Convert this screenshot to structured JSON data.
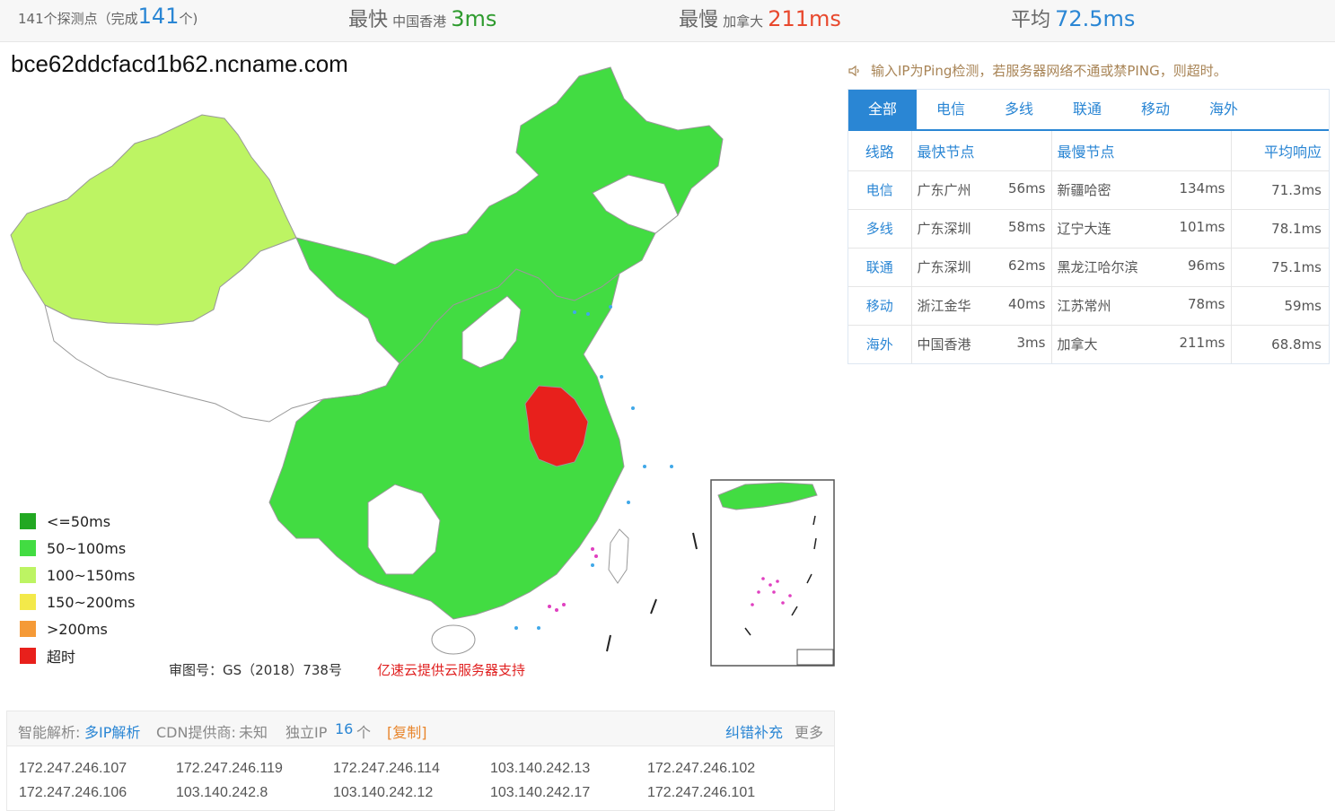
{
  "stats": {
    "count_prefix": "141个探测点（完成",
    "count_num": "141",
    "count_suffix": "个)",
    "fast_label": "最快",
    "fast_loc": "中国香港",
    "fast_val": "3ms",
    "slow_label": "最慢",
    "slow_loc": "加拿大",
    "slow_val": "211ms",
    "avg_label": "平均",
    "avg_val": "72.5ms"
  },
  "domain": "bce62ddcfacd1b62.ncname.com",
  "legend": [
    {
      "label": "<=50ms",
      "color": "#22a822"
    },
    {
      "label": "50~100ms",
      "color": "#42dc42"
    },
    {
      "label": "100~150ms",
      "color": "#bdf463"
    },
    {
      "label": ">200ms",
      "color": "#f59a37"
    },
    {
      "label": "150~200ms",
      "color": "#f3e94a"
    },
    {
      "label": "超时",
      "color": "#e8201c"
    }
  ],
  "map": {
    "caption": "审图号：GS（2018）738号",
    "sponsor": "亿速云提供云服务器支持"
  },
  "notice": "输入IP为Ping检测，若服务器网络不通或禁PING，则超时。",
  "tabs": [
    "全部",
    "电信",
    "多线",
    "联通",
    "移动",
    "海外"
  ],
  "table": {
    "headers": {
      "line": "线路",
      "fast": "最快节点",
      "slow": "最慢节点",
      "avg": "平均响应"
    },
    "rows": [
      {
        "line": "电信",
        "fast_loc": "广东广州",
        "fast_ms": "56ms",
        "slow_loc": "新疆哈密",
        "slow_ms": "134ms",
        "avg": "71.3ms"
      },
      {
        "line": "多线",
        "fast_loc": "广东深圳",
        "fast_ms": "58ms",
        "slow_loc": "辽宁大连",
        "slow_ms": "101ms",
        "avg": "78.1ms"
      },
      {
        "line": "联通",
        "fast_loc": "广东深圳",
        "fast_ms": "62ms",
        "slow_loc": "黑龙江哈尔滨",
        "slow_ms": "96ms",
        "avg": "75.1ms"
      },
      {
        "line": "移动",
        "fast_loc": "浙江金华",
        "fast_ms": "40ms",
        "slow_loc": "江苏常州",
        "slow_ms": "78ms",
        "avg": "59ms"
      },
      {
        "line": "海外",
        "fast_loc": "中国香港",
        "fast_ms": "3ms",
        "slow_loc": "加拿大",
        "slow_ms": "211ms",
        "avg": "68.8ms"
      }
    ]
  },
  "info": {
    "resolve_label": "智能解析:",
    "resolve_val": "多IP解析",
    "cdn_label": "CDN提供商:",
    "cdn_val": "未知",
    "ip_label": "独立IP",
    "ip_count": "16",
    "ip_unit": "个",
    "copy": "[复制]",
    "report": "纠错补充",
    "more": "更多"
  },
  "ips": [
    "172.247.246.107",
    "172.247.246.119",
    "172.247.246.114",
    "103.140.242.13",
    "172.247.246.102",
    "172.247.246.106",
    "103.140.242.8",
    "103.140.242.12",
    "103.140.242.17",
    "172.247.246.101"
  ]
}
